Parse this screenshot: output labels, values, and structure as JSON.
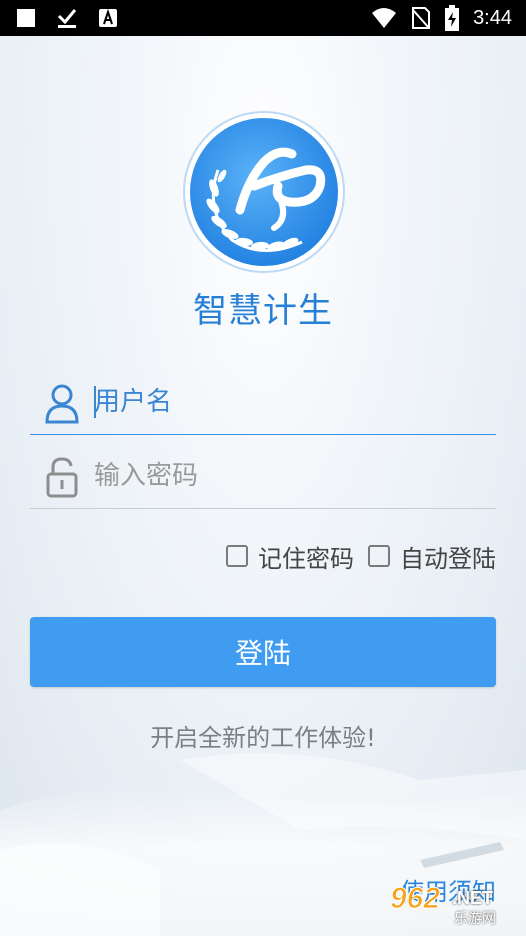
{
  "status_bar": {
    "time": "3:44",
    "icons": [
      "notification-square-icon",
      "download-done-icon",
      "app-a-icon",
      "wifi-icon",
      "no-sim-icon",
      "battery-charging-icon"
    ]
  },
  "app": {
    "title": "智慧计生",
    "logo_icon": "fp-laurel-logo-icon"
  },
  "login_form": {
    "username": {
      "placeholder": "用户名",
      "value": "",
      "icon": "user-icon"
    },
    "password": {
      "placeholder": "输入密码",
      "value": "",
      "icon": "lock-icon"
    },
    "remember_password": {
      "label": "记住密码",
      "checked": false
    },
    "auto_login": {
      "label": "自动登陆",
      "checked": false
    },
    "submit_label": "登陆"
  },
  "slogan": "开启全新的工作体验!",
  "notice_link": "使用须知",
  "watermark": {
    "number": "962",
    "net": ".NET",
    "cn": "乐游网"
  },
  "colors": {
    "accent": "#3f9cf0",
    "title_blue": "#2680d6",
    "status_bar": "#000000"
  }
}
